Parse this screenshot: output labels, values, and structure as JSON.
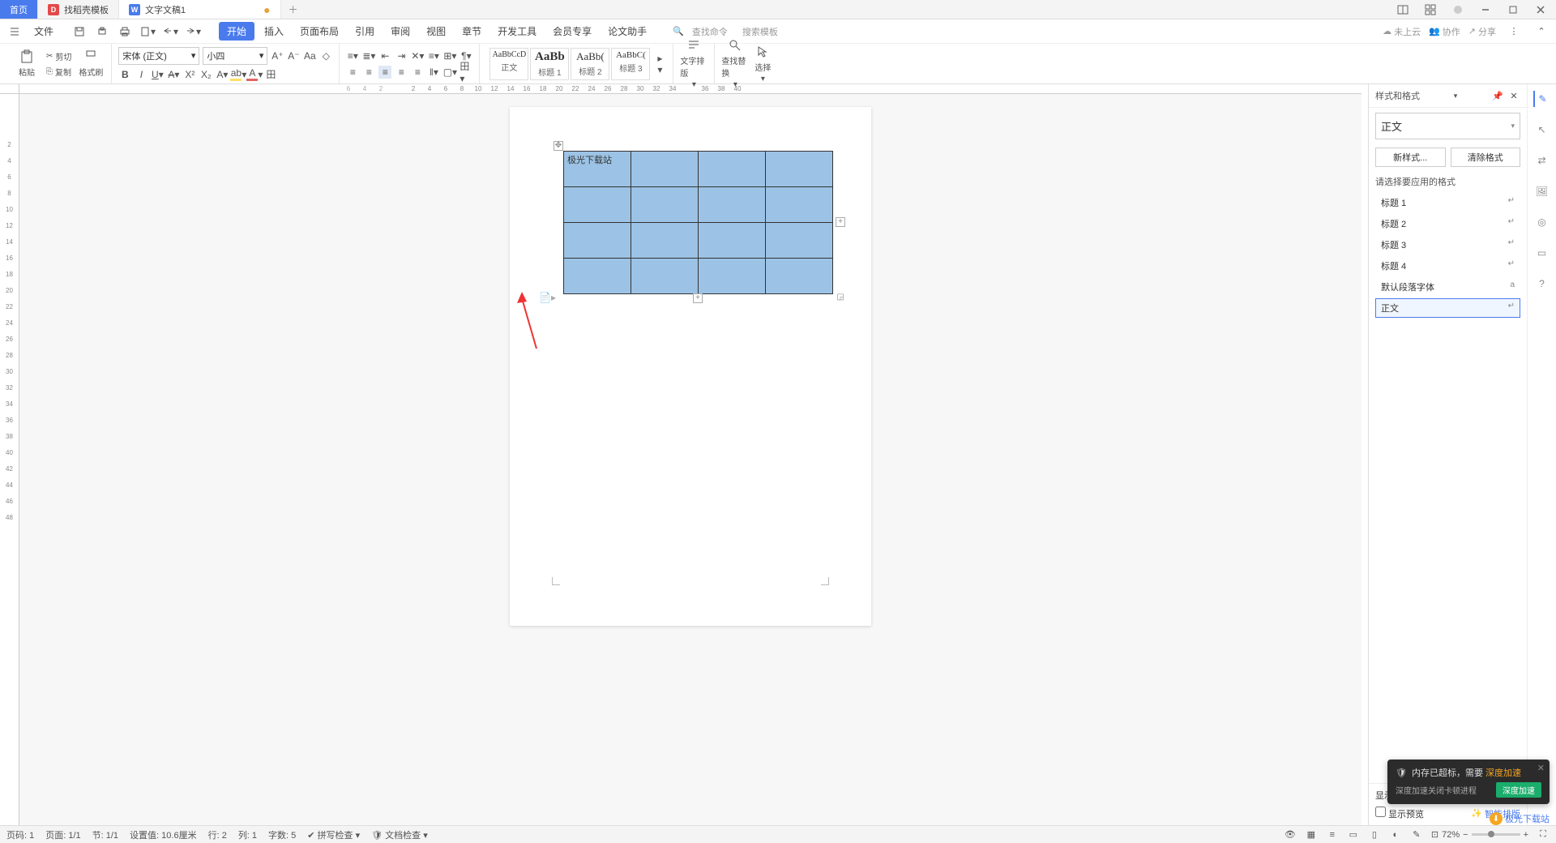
{
  "titlebar": {
    "tabs": [
      {
        "label": "首页",
        "icon": ""
      },
      {
        "label": "找稻壳模板",
        "icon": "D"
      },
      {
        "label": "文字文稿1",
        "icon": "W",
        "dirty": true
      }
    ]
  },
  "menubar": {
    "file": "文件",
    "items": [
      "开始",
      "插入",
      "页面布局",
      "引用",
      "审阅",
      "视图",
      "章节",
      "开发工具",
      "会员专享",
      "论文助手"
    ],
    "search_cmd_placeholder": "查找命令",
    "search_tpl_placeholder": "搜索模板",
    "cloud_status": "未上云",
    "collab": "协作",
    "share": "分享"
  },
  "ribbon": {
    "paste": "粘贴",
    "cut": "剪切",
    "copy": "复制",
    "fmt": "格式刷",
    "font_name": "宋体 (正文)",
    "font_size": "小四",
    "style_items": [
      {
        "preview": "AaBbCcD",
        "label": "正文",
        "size": "10px"
      },
      {
        "preview": "AaBb",
        "label": "标题 1",
        "size": "15px",
        "bold": true
      },
      {
        "preview": "AaBb(",
        "label": "标题 2",
        "size": "13px"
      },
      {
        "preview": "AaBbC(",
        "label": "标题 3",
        "size": "11px"
      }
    ],
    "text_layout": "文字排版",
    "find_replace": "查找替换",
    "select": "选择"
  },
  "ruler_h": [
    "6",
    "4",
    "2",
    "",
    "2",
    "4",
    "6",
    "8",
    "10",
    "12",
    "14",
    "16",
    "18",
    "20",
    "22",
    "24",
    "26",
    "28",
    "30",
    "32",
    "34",
    "",
    "36",
    "38",
    "40"
  ],
  "ruler_v": [
    "",
    "2",
    "4",
    "6",
    "8",
    "10",
    "12",
    "14",
    "16",
    "18",
    "20",
    "22",
    "24",
    "26",
    "28",
    "30",
    "32",
    "34",
    "36",
    "38",
    "40",
    "42",
    "44",
    "46",
    "48"
  ],
  "document": {
    "table_cell_text": "极光下载站"
  },
  "styles_panel": {
    "title": "样式和格式",
    "current": "正文",
    "btn_new": "新样式...",
    "btn_clear": "清除格式",
    "subtitle": "请选择要应用的格式",
    "list": [
      "标题 1",
      "标题 2",
      "标题 3",
      "标题 4",
      "默认段落字体",
      "正文"
    ],
    "selected": "正文",
    "show_label": "显示",
    "preview_checkbox": "显示预览",
    "smart_layout": "智能排版"
  },
  "toast": {
    "title_prefix": "内存已超标，需要",
    "title_action": "深度加速",
    "sub": "深度加速关闭卡顿进程",
    "btn": "深度加速"
  },
  "watermark": "极光下载站",
  "statusbar": {
    "page_num": "页码: 1",
    "page_of": "页面: 1/1",
    "section": "节: 1/1",
    "set_value": "设置值: 10.6厘米",
    "row": "行: 2",
    "col": "列: 1",
    "words": "字数: 5",
    "spell": "拼写检查",
    "doc_check": "文档检查",
    "zoom": "72%"
  }
}
